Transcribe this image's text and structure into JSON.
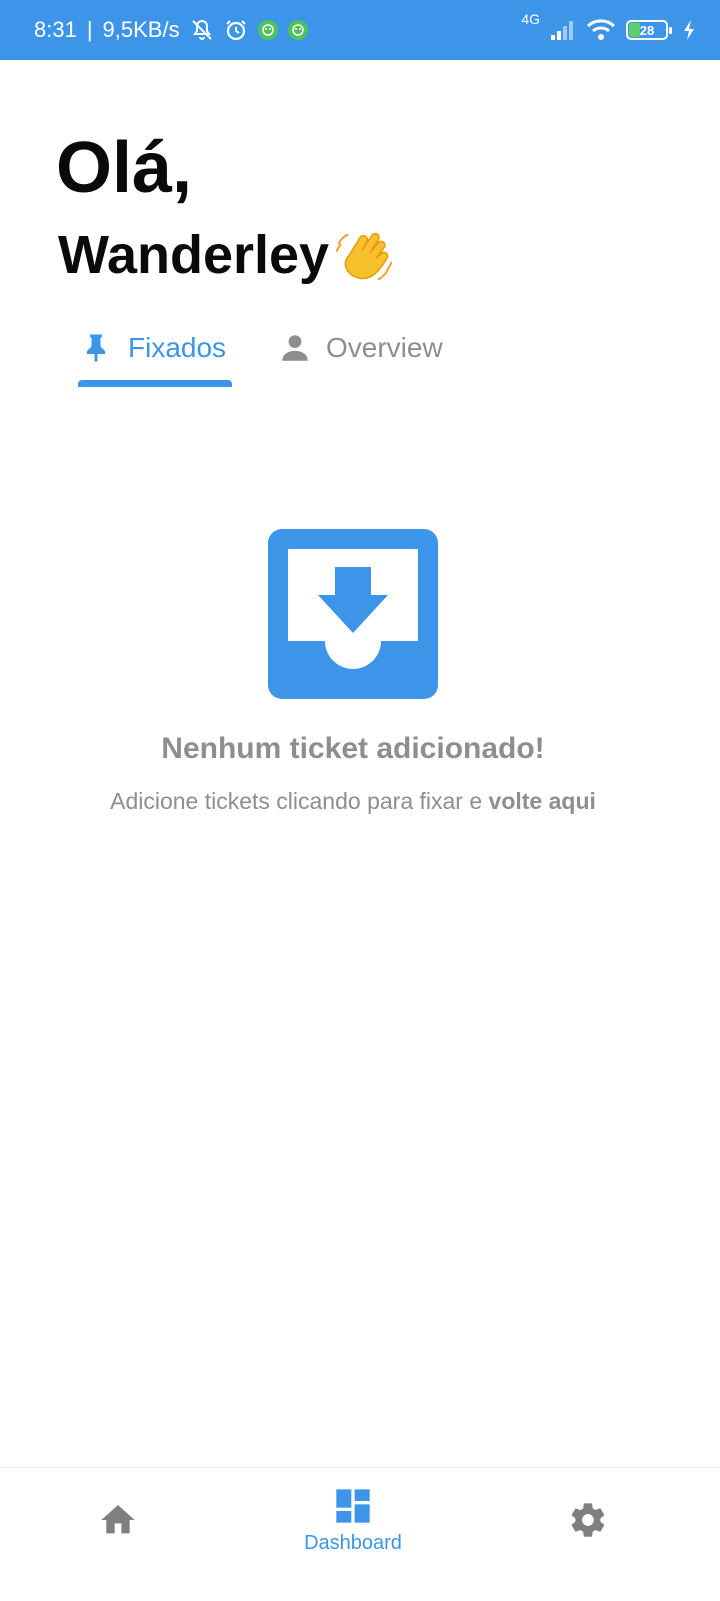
{
  "status_bar": {
    "time": "8:31",
    "separator": "|",
    "speed": "9,5KB/s",
    "network": "4G",
    "battery": "28",
    "icons": [
      "bell-off-icon",
      "alarm-icon",
      "app-icon",
      "app-icon",
      "signal-icon",
      "wifi-icon",
      "battery-icon",
      "charging-icon"
    ]
  },
  "greeting": {
    "hello": "Olá,",
    "name": "Wanderley",
    "emoji_icon": "waving-hand-icon"
  },
  "tabs": [
    {
      "label": "Fixados",
      "icon": "pin-icon",
      "active": true
    },
    {
      "label": "Overview",
      "icon": "person-icon",
      "active": false
    }
  ],
  "empty_state": {
    "icon": "inbox-download-icon",
    "title": "Nenhum ticket adicionado!",
    "description": "Adicione tickets clicando para fixar e ",
    "description_bold": "volte aqui"
  },
  "bottom_nav": {
    "items": [
      {
        "label": "",
        "icon": "home-icon",
        "active": false
      },
      {
        "label": "Dashboard",
        "icon": "dashboard-icon",
        "active": true
      },
      {
        "label": "",
        "icon": "gear-icon",
        "active": false
      }
    ]
  },
  "colors": {
    "accent": "#3d95ea",
    "muted": "#8e8e8e",
    "text": "#0a0a0a",
    "background": "#ffffff"
  }
}
